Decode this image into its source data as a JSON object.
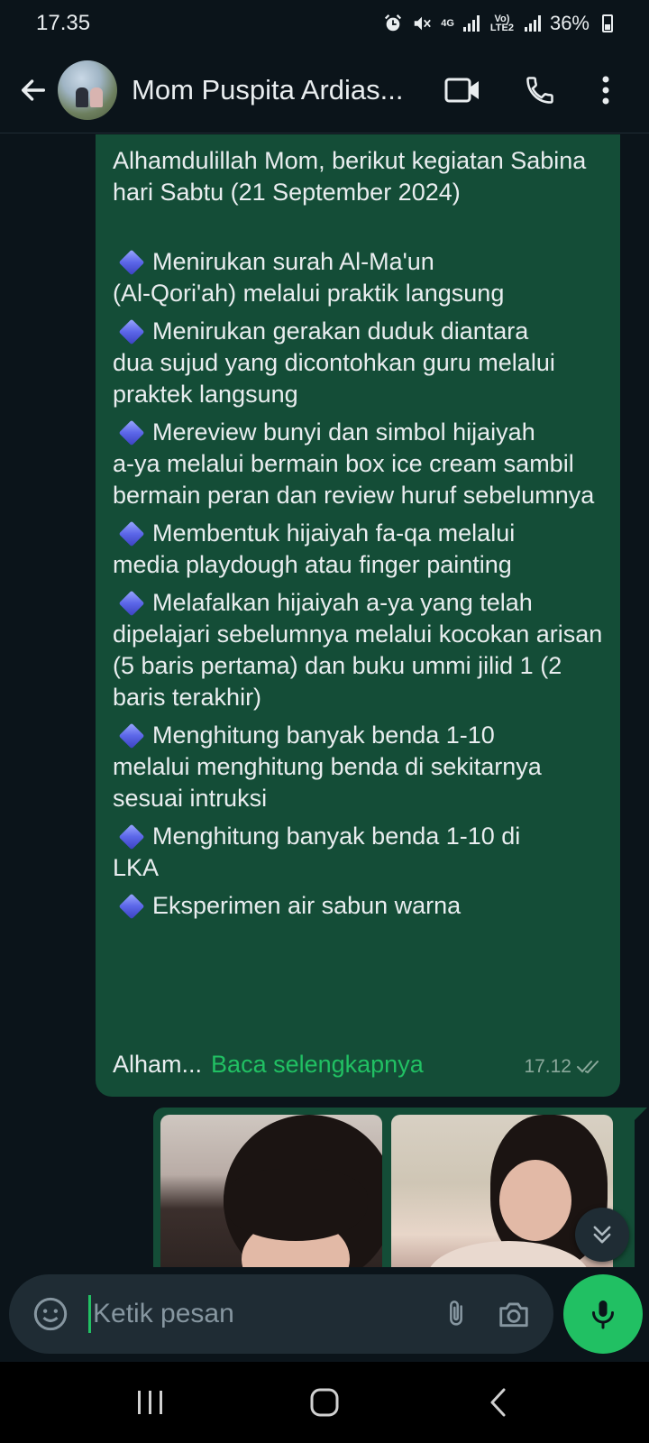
{
  "status_bar": {
    "time": "17.35",
    "network_4g": "4G",
    "network_volte": "Vo) LTE2",
    "battery": "36%"
  },
  "header": {
    "contact_name": "Mom Puspita Ardias...",
    "icons": [
      "back-arrow-icon",
      "video-call-icon",
      "voice-call-icon",
      "more-options-icon"
    ]
  },
  "message": {
    "intro": "Alhamdulillah Mom, berikut kegiatan Sabina hari Sabtu (21 September 2024)",
    "items": [
      {
        "first": "Menirukan surah Al-Ma'un",
        "rest": "(Al-Qori'ah) melalui praktik langsung"
      },
      {
        "first": "Menirukan gerakan duduk diantara",
        "rest": "dua sujud yang dicontohkan guru melalui praktek langsung"
      },
      {
        "first": "Mereview bunyi dan simbol hijaiyah",
        "rest": "a-ya melalui bermain box ice cream sambil bermain peran dan review huruf sebelumnya"
      },
      {
        "first": "Membentuk hijaiyah fa-qa melalui",
        "rest": "media playdough atau finger painting"
      },
      {
        "first": "Melafalkan hijaiyah a-ya yang telah",
        "rest": "dipelajari sebelumnya melalui kocokan arisan (5 baris pertama) dan buku ummi jilid 1 (2 baris terakhir)"
      },
      {
        "first": "Menghitung banyak benda 1-10",
        "rest": "melalui menghitung benda di sekitarnya sesuai intruksi"
      },
      {
        "first": "Menghitung banyak benda 1-10 di",
        "rest": "LKA"
      },
      {
        "first": "Eksperimen air sabun warna",
        "rest": ""
      }
    ],
    "truncated_text": "Alham...",
    "read_more": "Baca selengkapnya",
    "time": "17.12",
    "status": "read"
  },
  "composer": {
    "placeholder": "Ketik pesan"
  },
  "colors": {
    "background": "#0b141a",
    "bubble": "#144d37",
    "accent": "#21c063",
    "input_bg": "#1f2c34"
  }
}
